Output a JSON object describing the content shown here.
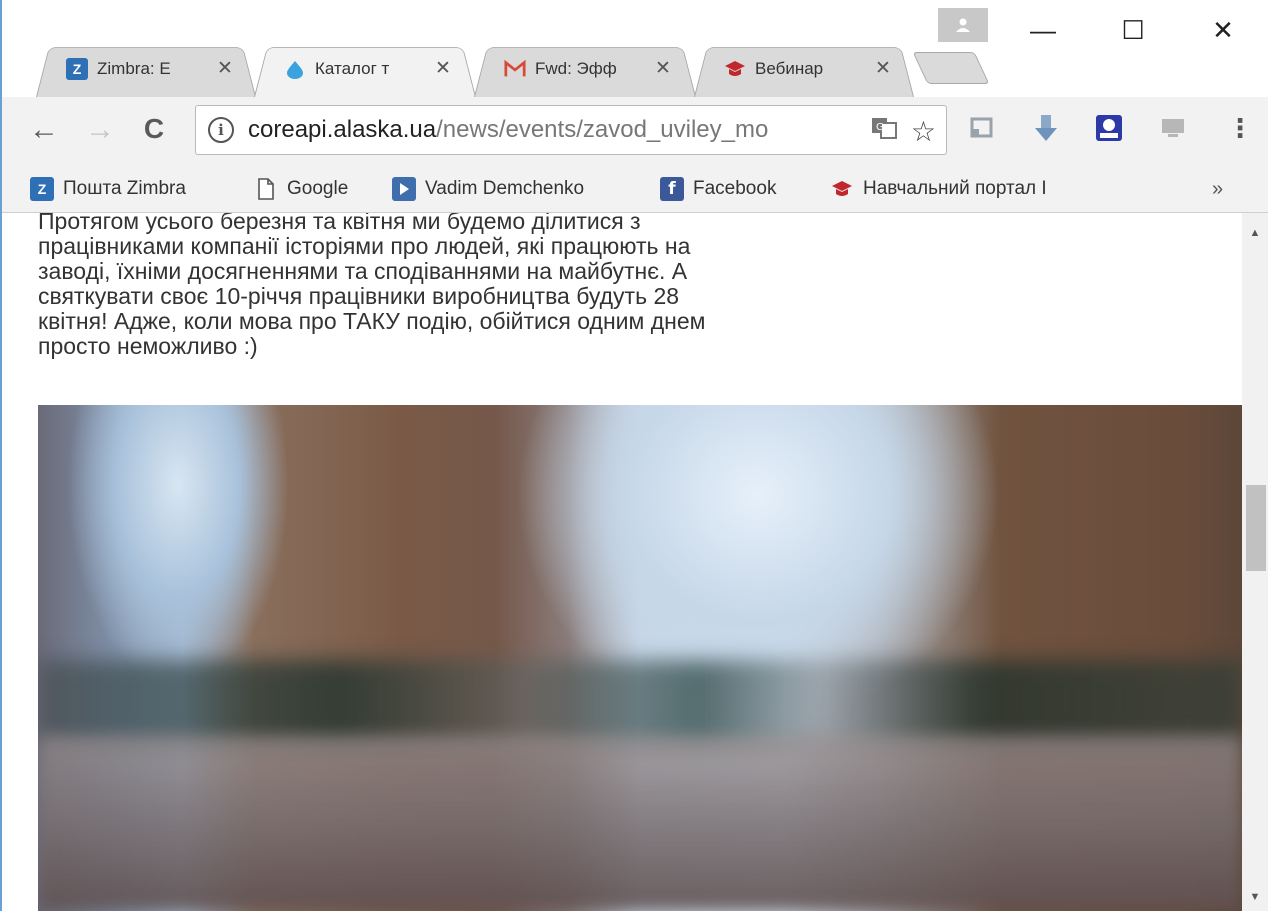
{
  "browser": {
    "tabs": [
      {
        "title": "Zimbra: E",
        "close": "✕",
        "icon": "zimbra-icon",
        "color": "#2f6fb5"
      },
      {
        "title": "Каталог т",
        "close": "✕",
        "icon": "drop-icon",
        "color": "#3aa2dc"
      },
      {
        "title": "Fwd: Эфф",
        "close": "✕",
        "icon": "gmail-icon",
        "color": "#d84a38"
      },
      {
        "title": "Вебинар",
        "close": "✕",
        "icon": "graduation-cap-icon",
        "color": "#c0282d"
      }
    ],
    "window_buttons": {
      "minimize": "—",
      "maximize": "☐",
      "close": "✕"
    },
    "nav": {
      "back": "←",
      "forward": "→",
      "reload": "C"
    },
    "omnibox": {
      "info": "i",
      "host": "coreapi.alaska.ua",
      "path": "/news/events/zavod_uviley_mo",
      "star": "☆"
    },
    "menu": "⋮"
  },
  "bookmarks": {
    "items": [
      {
        "label": "Пошта Zimbra",
        "icon": "zimbra-icon"
      },
      {
        "label": "Google",
        "icon": "page-icon"
      },
      {
        "label": "Vadim Demchenko",
        "icon": "play-icon"
      },
      {
        "label": "Facebook",
        "icon": "facebook-icon"
      },
      {
        "label": "Навчальний портал І",
        "icon": "graduation-cap-icon"
      }
    ],
    "overflow": "»"
  },
  "article": {
    "lines": [
      "Протягом усього березня та квітня ми будемо ділитися з",
      "працівниками компанії історіями  про людей, які працюють на",
      "заводі, їхніми досягненнями та сподіваннями на майбутнє. А",
      "святкувати своє 10-річчя працівники виробництва будуть 28",
      "квітня! Адже, коли мова про ТАКУ подію, обійтися одним днем",
      "просто неможливо :)"
    ]
  },
  "scrollbar": {
    "up": "▲",
    "down": "▼"
  }
}
